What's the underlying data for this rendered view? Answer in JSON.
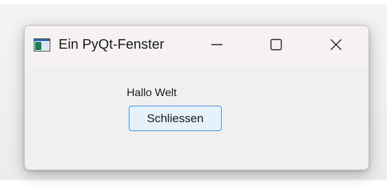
{
  "window": {
    "title": "Ein PyQt-Fenster",
    "icon": "app-window-icon",
    "controls": {
      "minimize_icon": "minimize-icon",
      "maximize_icon": "maximize-icon",
      "close_icon": "close-icon"
    }
  },
  "content": {
    "label_text": "Hallo Welt",
    "button_label": "Schliessen"
  },
  "colors": {
    "button_border": "#3c8fd6",
    "button_fill": "#e5f1fb",
    "window_bg": "#f0f0f0"
  }
}
